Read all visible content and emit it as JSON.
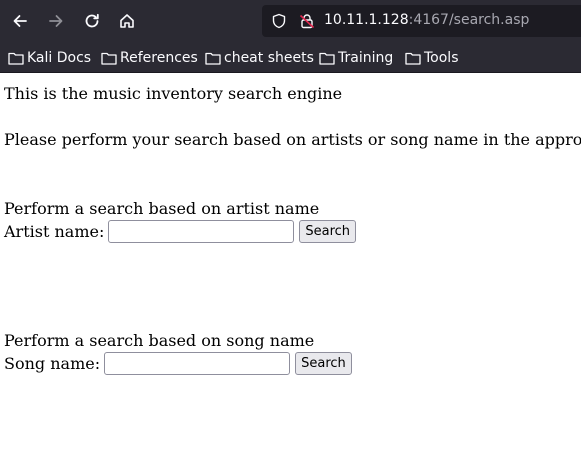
{
  "browser": {
    "url_host": "10.11.1.128",
    "url_rest": ":4167/search.asp",
    "bookmarks": [
      "Kali Docs",
      "References",
      "cheat sheets",
      "Training",
      "Tools"
    ]
  },
  "page": {
    "heading": "This is the music inventory search engine",
    "instructions": "Please perform your search based on artists or song name in the appropriat",
    "artist_section": {
      "title": "Perform a search based on artist name",
      "label": "Artist name:",
      "value": "",
      "button": "Search"
    },
    "song_section": {
      "title": "Perform a search based on song name",
      "label": "Song name:",
      "value": "",
      "button": "Search"
    }
  }
}
